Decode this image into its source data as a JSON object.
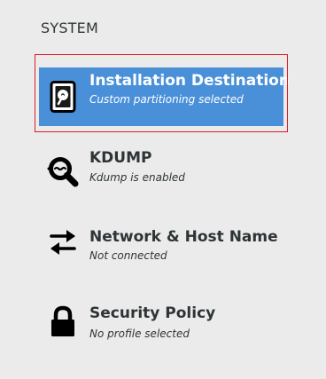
{
  "section": {
    "heading": "SYSTEM"
  },
  "colors": {
    "selected_background": "#4a90d9",
    "focus_ring": "#e01b24",
    "background": "#ebebeb"
  },
  "spokes": [
    {
      "title": "Installation Destination",
      "status": "Custom partitioning selected",
      "icon": "hard-disk-icon",
      "selected": true
    },
    {
      "title": "KDUMP",
      "status": "Kdump is enabled",
      "icon": "magnifier-icon",
      "selected": false
    },
    {
      "title": "Network & Host Name",
      "status": "Not connected",
      "icon": "network-arrows-icon",
      "selected": false
    },
    {
      "title": "Security Policy",
      "status": "No profile selected",
      "icon": "padlock-icon",
      "selected": false
    }
  ]
}
